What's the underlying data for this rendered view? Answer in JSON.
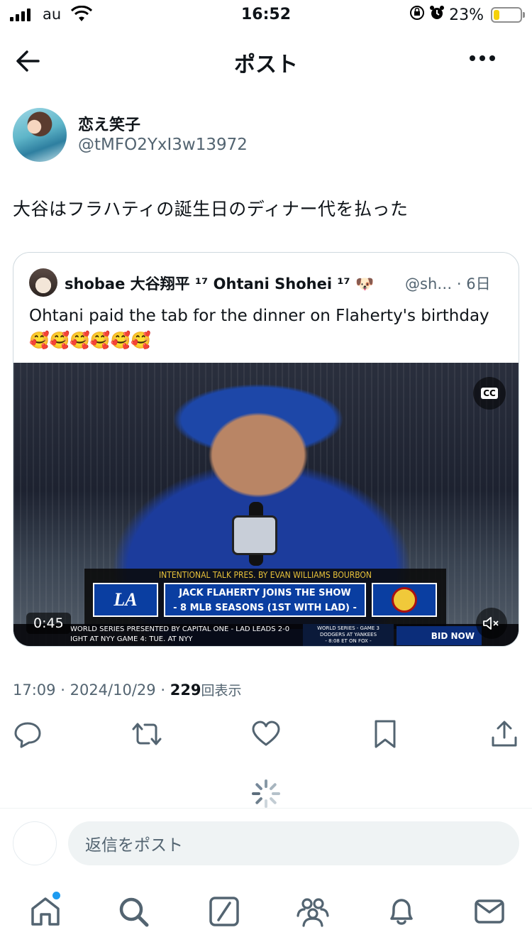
{
  "status_bar": {
    "carrier": "au",
    "time": "16:52",
    "battery_percent": "23%",
    "battery_level": 0.23,
    "icons": [
      "signal-icon",
      "wifi-icon",
      "orientation-lock-icon",
      "alarm-icon",
      "battery-icon"
    ]
  },
  "header": {
    "title": "ポスト",
    "icons": [
      "back-arrow-icon",
      "more-icon"
    ]
  },
  "post": {
    "author_name": "恋え笑子",
    "author_handle": "@tMFO2YxI3w13972",
    "text": "大谷はフラハティの誕生日のディナー代を払った",
    "time": "17:09",
    "date": "2024/10/29",
    "separator": "·",
    "views_count": "229",
    "views_label": "回表示"
  },
  "quote": {
    "author_name": "shobae 大谷翔平 ¹⁷ Ohtani Shohei ¹⁷ 🐶",
    "author_handle": "@sh… · 6日",
    "text": "Ohtani paid the tab for the dinner on Flaherty's birthday 🥰🥰🥰🥰🥰🥰",
    "video": {
      "duration": "0:45",
      "cc_label": "CC",
      "lower_third_title": "INTENTIONAL TALK PRES. BY EVAN WILLIAMS BOURBON",
      "team_logo_text": "LA",
      "headline_line1": "JACK FLAHERTY JOINS THE SHOW",
      "headline_line2": "- 8 MLB SEASONS (1ST WITH LAD) -",
      "ticker_line1": "WORLD SERIES PRESENTED BY CAPITAL ONE - LAD LEADS 2-0",
      "ticker_line2": "IGHT AT NYY    GAME 4: TUE. AT NYY",
      "ticker_box_line1": "WORLD SERIES - GAME 3",
      "ticker_box_line2": "DODGERS AT YANKEES",
      "ticker_box_line3": "- 8:08 ET ON FOX -",
      "ticker_button": "BID NOW"
    }
  },
  "actions": [
    "reply-icon",
    "repost-icon",
    "like-icon",
    "bookmark-icon",
    "share-icon"
  ],
  "reply": {
    "placeholder": "返信をポスト"
  },
  "tabbar": [
    "home-icon",
    "search-icon",
    "grok-icon",
    "communities-icon",
    "notifications-icon",
    "messages-icon"
  ],
  "colors": {
    "text": "#0f1419",
    "secondary": "#536471",
    "border": "#cfd9de",
    "accent": "#1d9bf0",
    "battery": "#f5d10a"
  }
}
